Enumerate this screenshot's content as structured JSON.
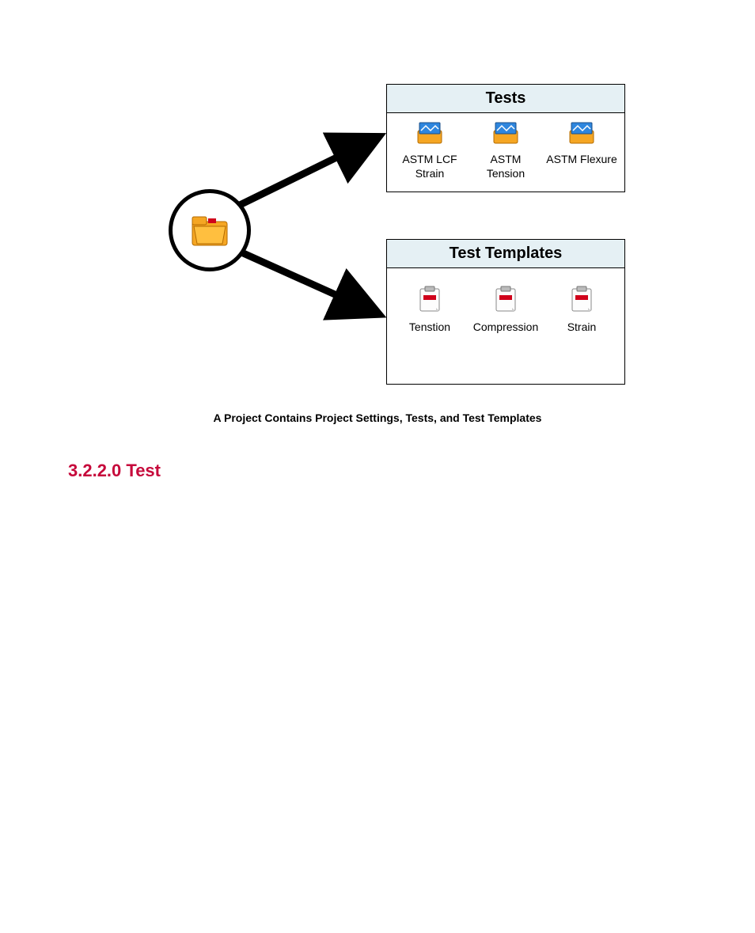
{
  "diagram": {
    "tests": {
      "title": "Tests",
      "items": [
        {
          "label": "ASTM LCF Strain"
        },
        {
          "label": "ASTM Tension"
        },
        {
          "label": "ASTM Flexure"
        }
      ]
    },
    "templates": {
      "title": "Test Templates",
      "items": [
        {
          "label": "Tenstion"
        },
        {
          "label": "Compression"
        },
        {
          "label": "Strain"
        }
      ]
    },
    "caption": "A Project Contains Project Settings, Tests, and Test Templates"
  },
  "heading": "3.2.2.0 Test"
}
